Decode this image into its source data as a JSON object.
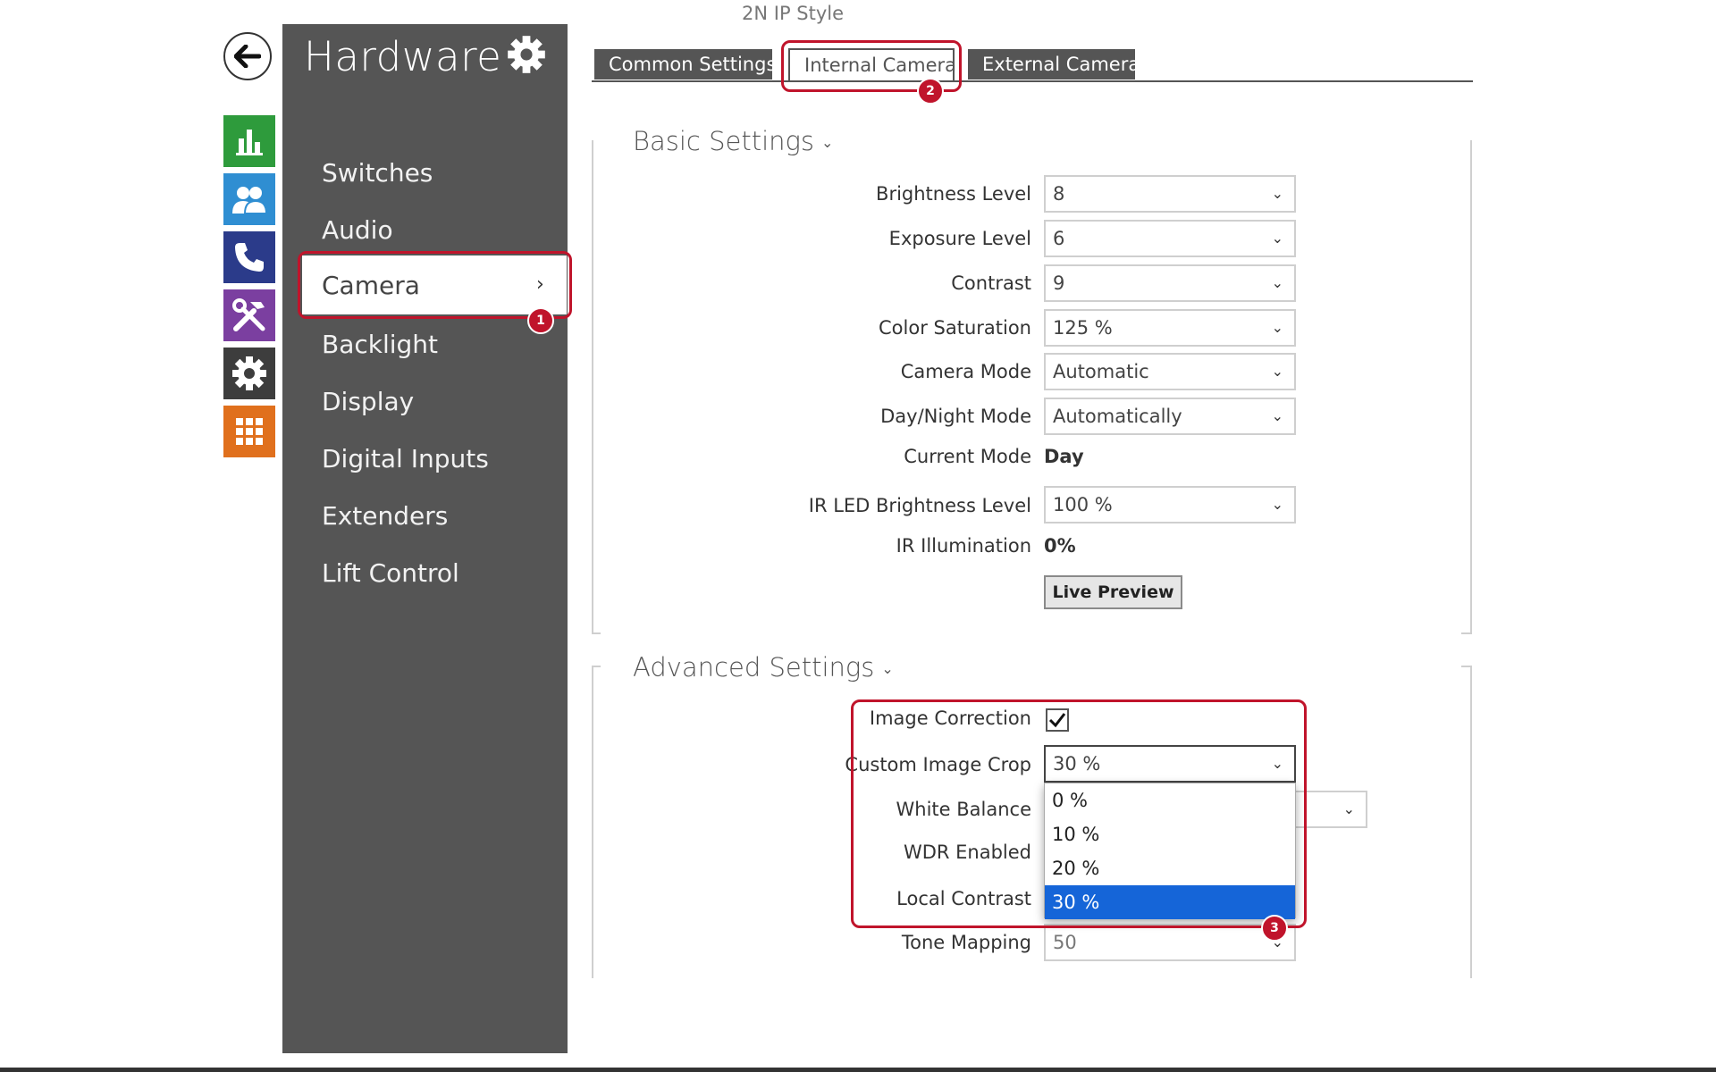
{
  "app_title": "2N IP Style",
  "sidebar": {
    "title": "Hardware",
    "items": [
      {
        "label": "Switches"
      },
      {
        "label": "Audio"
      },
      {
        "label": "Camera"
      },
      {
        "label": "Backlight"
      },
      {
        "label": "Display"
      },
      {
        "label": "Digital Inputs"
      },
      {
        "label": "Extenders"
      },
      {
        "label": "Lift Control"
      }
    ],
    "active_item": "Camera",
    "active_chevron": "›"
  },
  "rail": {
    "icons": [
      {
        "name": "back-arrow-icon"
      },
      {
        "name": "status-chart-icon",
        "color": "#2e9b3c"
      },
      {
        "name": "users-icon",
        "color": "#2f8ed2"
      },
      {
        "name": "phone-icon",
        "color": "#2b3b8a"
      },
      {
        "name": "hardware-tools-icon",
        "color": "#7b3fa0"
      },
      {
        "name": "system-gear-icon",
        "color": "#3d3d3d"
      },
      {
        "name": "services-grid-icon",
        "color": "#e0701d"
      }
    ]
  },
  "tabs": [
    {
      "label": "Common Settings"
    },
    {
      "label": "Internal Camera"
    },
    {
      "label": "External Camera"
    }
  ],
  "callouts": [
    "1",
    "2",
    "3"
  ],
  "basic": {
    "title": "Basic Settings",
    "fields": {
      "brightness": {
        "label": "Brightness Level",
        "value": "8"
      },
      "exposure": {
        "label": "Exposure Level",
        "value": "6"
      },
      "contrast": {
        "label": "Contrast",
        "value": "9"
      },
      "saturation": {
        "label": "Color Saturation",
        "value": "125 %"
      },
      "camera_mode": {
        "label": "Camera Mode",
        "value": "Automatic"
      },
      "day_night": {
        "label": "Day/Night Mode",
        "value": "Automatically"
      },
      "current_mode": {
        "label": "Current Mode",
        "value": "Day"
      },
      "ir_led": {
        "label": "IR LED Brightness Level",
        "value": "100 %"
      },
      "ir_illum": {
        "label": "IR Illumination",
        "value": "0%"
      }
    },
    "live_preview": "Live Preview"
  },
  "advanced": {
    "title": "Advanced Settings",
    "fields": {
      "image_correction": {
        "label": "Image Correction",
        "checked": true
      },
      "image_crop": {
        "label": "Custom Image Crop",
        "value": "30 %"
      },
      "white_balance": {
        "label": "White Balance"
      },
      "wdr": {
        "label": "WDR Enabled"
      },
      "local_contrast": {
        "label": "Local Contrast"
      },
      "tone_mapping": {
        "label": "Tone Mapping",
        "value": "50"
      }
    },
    "crop_options": [
      "0 %",
      "10 %",
      "20 %",
      "30 %"
    ],
    "crop_selected": "30 %"
  },
  "colors": {
    "accent_red": "#c0142b",
    "selection_blue": "#1565d8",
    "sidebar_bg": "#555555"
  }
}
